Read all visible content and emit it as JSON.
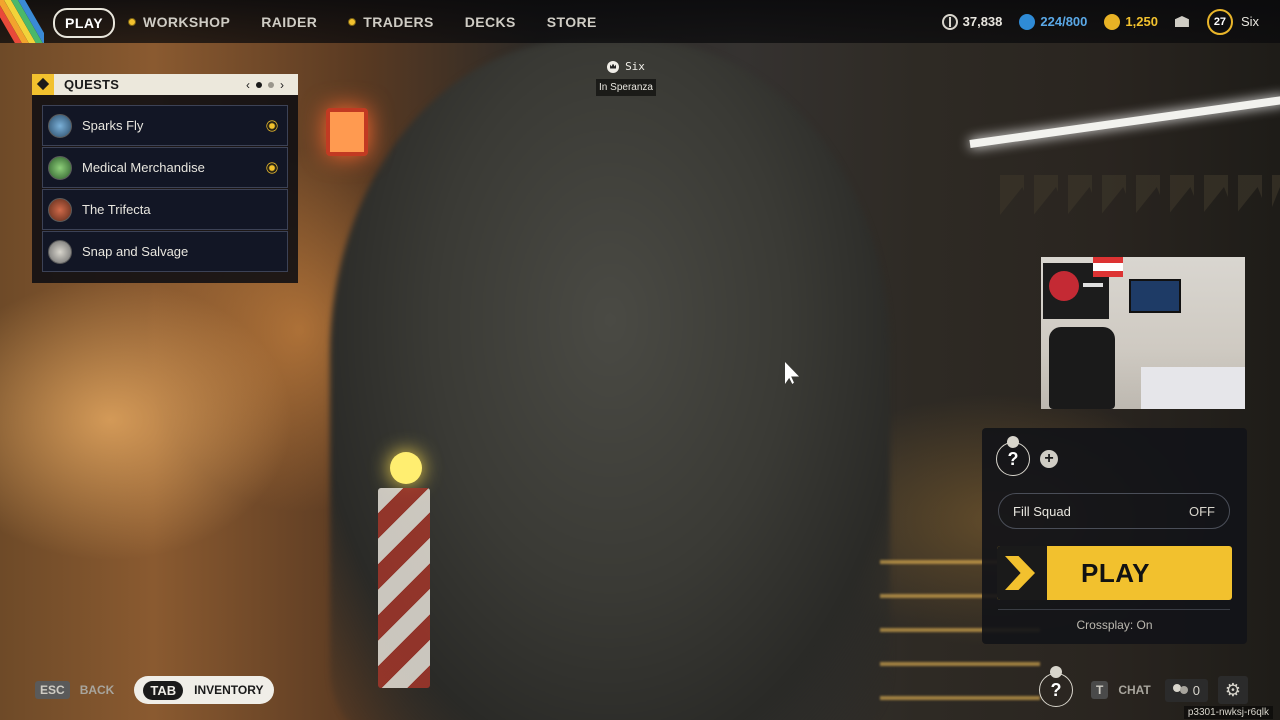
{
  "topbar": {
    "play_label": "PLAY",
    "nav": [
      {
        "label": "WORKSHOP",
        "dot": true
      },
      {
        "label": "RAIDER",
        "dot": false
      },
      {
        "label": "TRADERS",
        "dot": true
      },
      {
        "label": "DECKS",
        "dot": false
      },
      {
        "label": "STORE",
        "dot": false
      }
    ],
    "currency_coins": "37,838",
    "currency_blue": "224/800",
    "currency_gold": "1,250",
    "level": "27",
    "username": "Six"
  },
  "player_tag": {
    "name": "Six",
    "location": "In Speranza"
  },
  "quests": {
    "title": "QUESTS",
    "items": [
      {
        "label": "Sparks Fly",
        "tracked": true
      },
      {
        "label": "Medical Merchandise",
        "tracked": true
      },
      {
        "label": "The Trifecta",
        "tracked": false
      },
      {
        "label": "Snap and Salvage",
        "tracked": false
      }
    ]
  },
  "squad": {
    "slot_label": "?",
    "fill_squad_label": "Fill Squad",
    "fill_squad_value": "OFF",
    "play_label": "PLAY",
    "crossplay": "Crossplay: On"
  },
  "bottom": {
    "esc_key": "ESC",
    "back_label": "BACK",
    "tab_key": "TAB",
    "inventory_label": "INVENTORY",
    "slot_label": "?",
    "t_key": "T",
    "chat_label": "CHAT",
    "friends_count": "0",
    "session_id": "p3301-nwksj-r6qlk"
  },
  "colors": {
    "accent_yellow": "#f2c12e",
    "panel_dark": "#121625"
  }
}
